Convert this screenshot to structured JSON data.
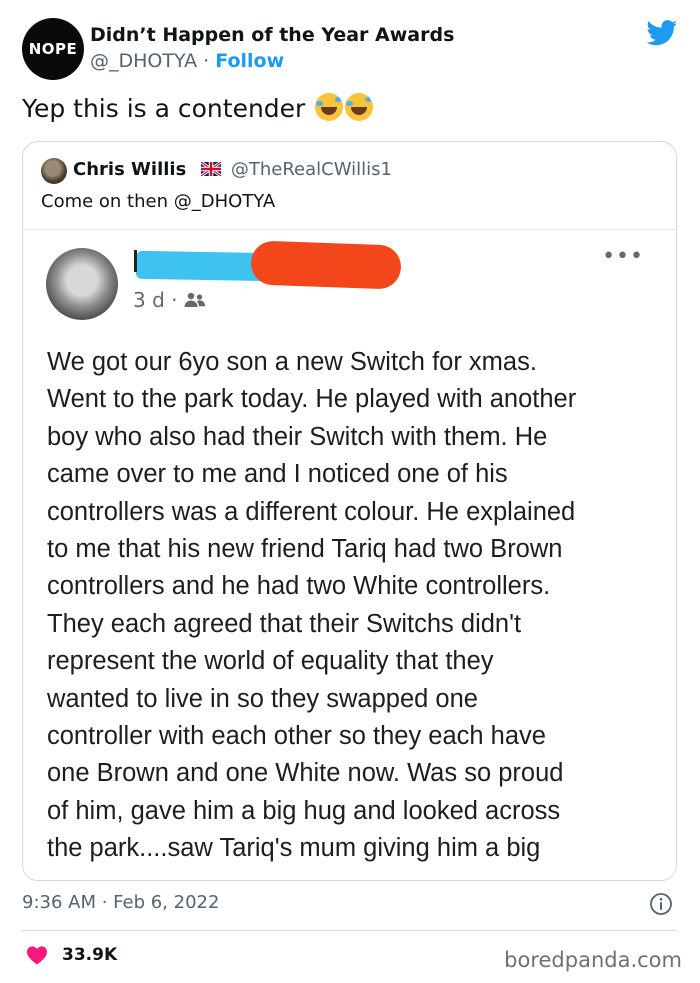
{
  "tweet": {
    "author_name": "Didn’t Happen of the Year Awards",
    "author_handle": "@_DHOTYA",
    "separator": "·",
    "follow_label": "Follow",
    "avatar_text": "NOPE",
    "text": "Yep this is a contender",
    "timestamp": "9:36 AM · Feb 6, 2022",
    "like_count": "33.9K"
  },
  "quote": {
    "author_name": "Chris Willis",
    "author_handle": "@TheRealCWillis1",
    "text": "Come on then @_DHOTYA"
  },
  "post": {
    "time": "3 d",
    "separator": "·",
    "more": "•••",
    "lines": [
      "We got our 6yo son a new Switch for xmas.",
      "Went to the park today. He played with another",
      "boy who also had their Switch with them. He",
      "came over to me and I noticed one of his",
      "controllers was a different colour. He explained",
      "to me that his new friend Tariq had two Brown",
      "controllers and he had two White controllers.",
      "They each agreed that their Switchs didn't",
      "represent the world of equality that they",
      "wanted to live in so they swapped one",
      "controller with each other so they each have",
      "one Brown and one White now. Was so proud",
      "of him, gave him a big hug and looked across",
      "the park....saw Tariq's mum giving him a big"
    ]
  },
  "watermark": "boredpanda.com",
  "colors": {
    "accent": "#1d9bf0",
    "heart": "#f91880",
    "redaction_blue": "#3ec3f0",
    "redaction_red": "#f3461a"
  },
  "icons": [
    "twitter-bird-icon",
    "uk-flag-icon",
    "people-icon",
    "info-icon",
    "heart-icon",
    "emoji-rofl-icon"
  ]
}
